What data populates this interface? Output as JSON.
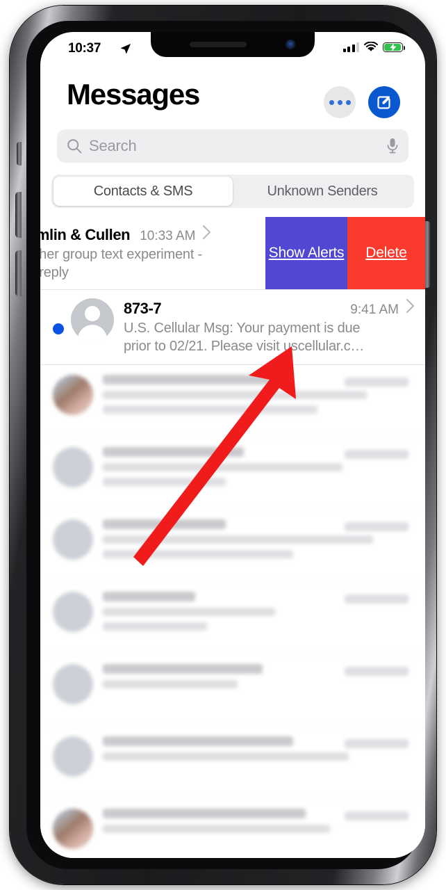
{
  "status_bar": {
    "time": "10:37",
    "location_icon": "location-arrow-icon",
    "cellular_icon": "cellular-bars-icon",
    "wifi_icon": "wifi-icon",
    "battery_icon": "battery-charging-icon",
    "battery_color": "#30c14e"
  },
  "header": {
    "title": "Messages",
    "more_options_icon": "ellipsis-icon",
    "compose_icon": "compose-pencil-icon",
    "compose_button_color": "#0a58d0"
  },
  "search": {
    "placeholder": "Search",
    "search_icon": "search-icon",
    "mic_icon": "microphone-icon"
  },
  "segmented_control": {
    "options": [
      {
        "label": "Contacts & SMS",
        "selected": true
      },
      {
        "label": "Unknown Senders",
        "selected": false
      }
    ]
  },
  "conversations": {
    "swiped_row": {
      "name": "amlin & Cullen",
      "time": "10:33 AM",
      "preview": "other group text experiment -\no reply",
      "chevron_icon": "chevron-right-icon",
      "actions": [
        {
          "label": "Show\nAlerts",
          "color": "#5048d2",
          "name": "show-alerts"
        },
        {
          "label": "Delete",
          "color": "#fb3a2e",
          "name": "delete"
        }
      ]
    },
    "unread_row": {
      "name": "873-7",
      "time": "9:41 AM",
      "preview": "U.S. Cellular Msg: Your payment is due\nprior to 02/21. Please visit uscellular.c…",
      "unread": true,
      "unread_dot_color": "#0a53e0",
      "avatar_icon": "person-placeholder-avatar",
      "chevron_icon": "chevron-right-icon"
    },
    "blurred_rows_count": 7
  },
  "annotation": {
    "arrow_color": "#f01c1c",
    "arrow_from": "178,793",
    "arrow_to": "395,520"
  }
}
